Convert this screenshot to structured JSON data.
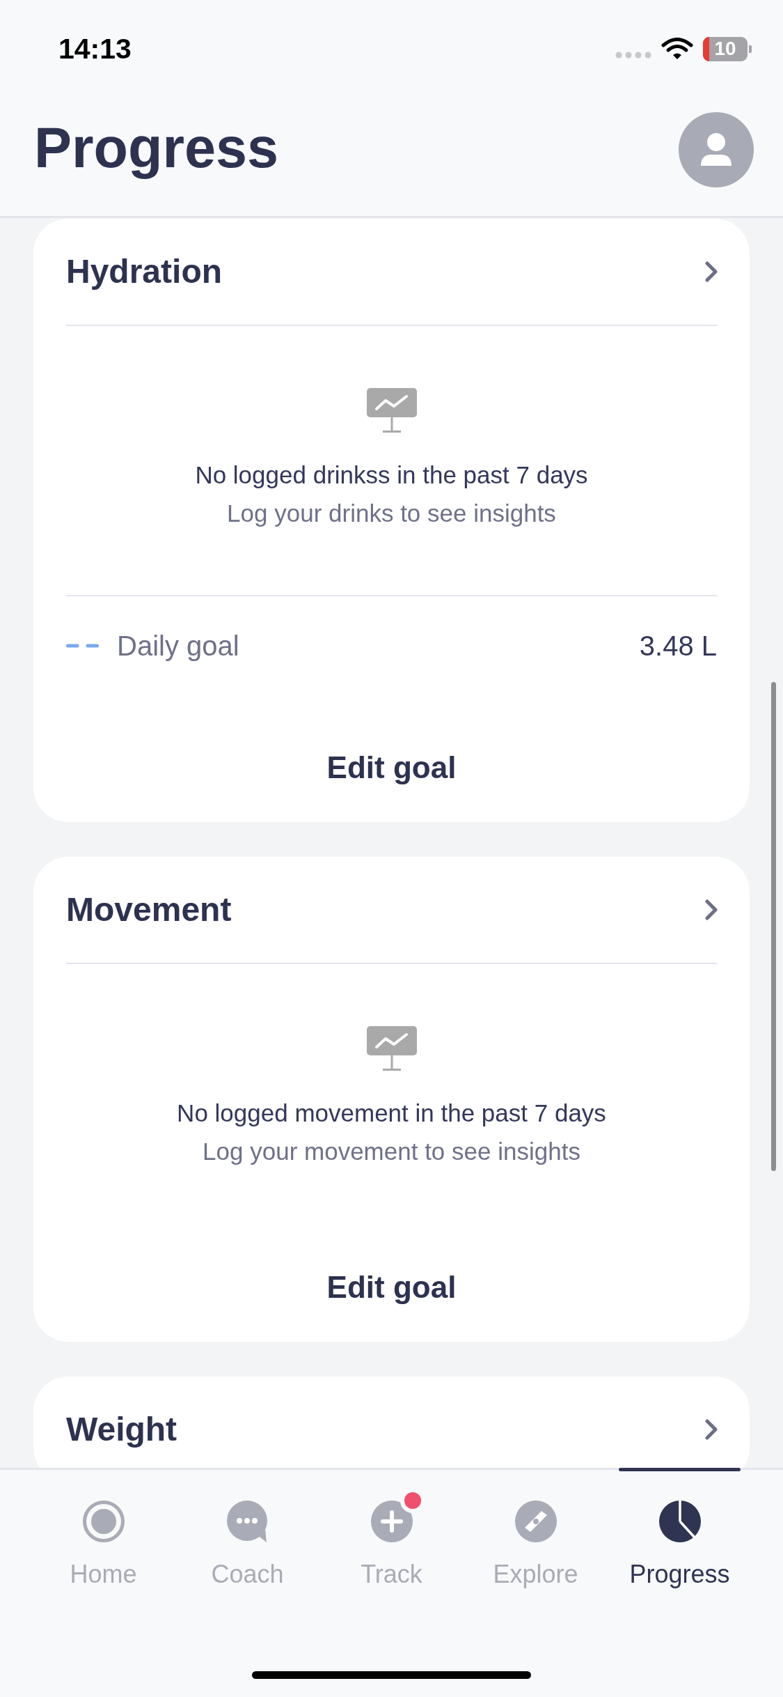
{
  "status_bar": {
    "time": "14:13",
    "battery": "10"
  },
  "header": {
    "title": "Progress"
  },
  "cards": [
    {
      "title": "Hydration",
      "empty_state": {
        "message": "No logged drinkss in the past 7 days",
        "hint": "Log your drinks to see insights"
      },
      "goal": {
        "label": "Daily goal",
        "value": "3.48 L"
      },
      "action": "Edit goal"
    },
    {
      "title": "Movement",
      "empty_state": {
        "message": "No logged movement in the past 7 days",
        "hint": "Log your movement to see insights"
      },
      "action": "Edit goal"
    },
    {
      "title": "Weight"
    }
  ],
  "tab_bar": {
    "tabs": [
      {
        "label": "Home",
        "selected": false,
        "badge": false
      },
      {
        "label": "Coach",
        "selected": false,
        "badge": false
      },
      {
        "label": "Track",
        "selected": false,
        "badge": true
      },
      {
        "label": "Explore",
        "selected": false,
        "badge": false
      },
      {
        "label": "Progress",
        "selected": true,
        "badge": false
      }
    ]
  }
}
